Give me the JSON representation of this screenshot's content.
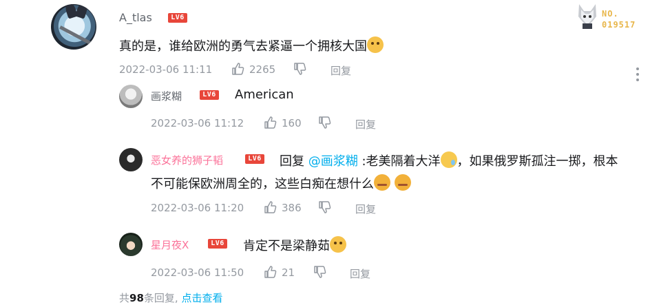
{
  "main_comment": {
    "username": "A_tlas",
    "level": "LV6",
    "content": "真的是，谁给欧洲的勇气去紧逼一个拥核大国",
    "date": "2022-03-06 11:11",
    "likes": "2265",
    "reply_label": "回复",
    "fan_badge_no_label": "NO.",
    "fan_badge_number": "019517"
  },
  "replies": [
    {
      "username": "画浆糊",
      "level": "LV6",
      "content": "American",
      "date": "2022-03-06 11:12",
      "likes": "160",
      "reply_label": "回复"
    },
    {
      "username": "恶女养的狮子韬",
      "level": "LV6",
      "reply_prefix": "回复 ",
      "reply_target": "@画浆糊",
      "content_line1": " :老美隔着大洋",
      "content_line1b": "，如果俄罗斯孤注一掷，根本",
      "content_line2": "不可能保欧洲周全的，这些白痴在想什么",
      "date": "2022-03-06 11:20",
      "likes": "386",
      "reply_label": "回复"
    },
    {
      "username": "星月夜X",
      "level": "LV6",
      "content": "肯定不是梁静茹",
      "date": "2022-03-06 11:50",
      "likes": "21",
      "reply_label": "回复"
    }
  ],
  "footer": {
    "prefix": "共",
    "count": "98",
    "suffix": "条回复,",
    "view_more": "点击查看"
  },
  "icons": {
    "like": "thumbs-up-icon",
    "dislike": "thumbs-down-icon",
    "more": "more-vertical-icon"
  }
}
